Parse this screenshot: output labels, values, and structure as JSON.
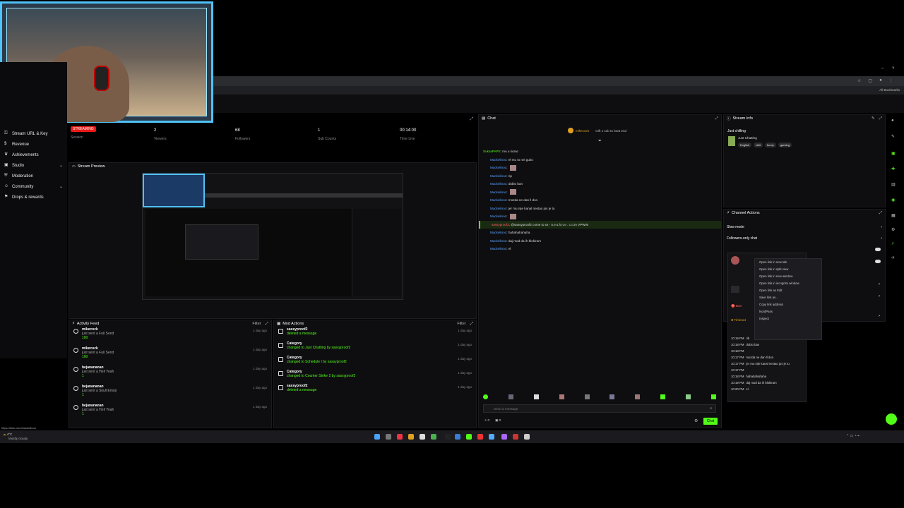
{
  "webcam": {
    "label": ""
  },
  "browser": {
    "bookmarks_label": "All Bookmarks"
  },
  "sidebar": {
    "items": [
      {
        "icon": "key-icon",
        "label": "Stream URL & Key",
        "chevron": false
      },
      {
        "icon": "dollar-icon",
        "label": "Revenue",
        "chevron": false
      },
      {
        "icon": "trophy-icon",
        "label": "Achievements",
        "chevron": false
      },
      {
        "icon": "studio-icon",
        "label": "Studio",
        "chevron": true
      },
      {
        "icon": "shield-icon",
        "label": "Moderation",
        "chevron": false
      },
      {
        "icon": "people-icon",
        "label": "Community",
        "chevron": true
      },
      {
        "icon": "gift-icon",
        "label": "Drops & rewards",
        "chevron": false
      }
    ]
  },
  "stats": {
    "status": "STREAMING",
    "session_label": "Session",
    "viewers": {
      "value": "2",
      "label": "Viewers"
    },
    "followers": {
      "value": "68",
      "label": "Followers"
    },
    "subs": {
      "value": "1",
      "label": "Sub Counts"
    },
    "time": {
      "value": "00:14:00",
      "label": "Time Live"
    }
  },
  "preview": {
    "title": "Stream Preview"
  },
  "activity": {
    "title": "Activity Feed",
    "filter": "Filter",
    "rows": [
      {
        "user": "mikecock",
        "desc": "just sent a Full Send",
        "amount": "100",
        "time": "1 day ago"
      },
      {
        "user": "mikecock",
        "desc": "just sent a Full Send",
        "amount": "100",
        "time": "1 day ago"
      },
      {
        "user": "bejanananan",
        "desc": "just sent a Hell Yeah",
        "amount": "1",
        "time": "1 day ago"
      },
      {
        "user": "bejanananan",
        "desc": "just sent a Skull Emoji",
        "amount": "1",
        "time": "1 day ago"
      },
      {
        "user": "bejanananan",
        "desc": "just sent a Hell Yeah",
        "amount": "1",
        "time": "1 day ago"
      }
    ]
  },
  "mod_actions": {
    "title": "Mod Actions",
    "filter": "Filter",
    "rows": [
      {
        "user": "sassyproof2",
        "desc": "deleted a message",
        "time": "1 day ago"
      },
      {
        "user": "Category",
        "desc": "changed to Just Chatting by sassyproof2",
        "time": "1 day ago"
      },
      {
        "user": "Category",
        "desc": "changed to Schedule I by sassyproof2",
        "time": "1 day ago"
      },
      {
        "user": "Category",
        "desc": "changed to Counter Strike 2 by sassyproof2",
        "time": "1 day ago"
      },
      {
        "user": "sassyproof2",
        "desc": "deleted a message",
        "time": "1 day ago"
      }
    ]
  },
  "chat": {
    "title": "Chat",
    "pinned_user": "mikecock",
    "pinned_note": "Gift 1 sub to beat 2nd",
    "lines": [
      {
        "user": "SuksaPAPE",
        "text": "mu u kurac",
        "pn": true
      },
      {
        "user": "Mackelinoo",
        "text": "el mu to nei guko"
      },
      {
        "user": "Mackelinoo",
        "text": ""
      },
      {
        "user": "Mackelinoo",
        "text": "rip"
      },
      {
        "user": "Mackelinoo",
        "text": "dobio ban"
      },
      {
        "user": "Mackelinoo",
        "text": ""
      },
      {
        "user": "Mackelinoo",
        "text": "mozda ne dan ll dva"
      },
      {
        "user": "Mackelinoo",
        "text": "jer mu nije kanal nestao jos je tu"
      },
      {
        "user": "Mackelinoo",
        "text": ""
      },
      {
        "user": "sassyproof2",
        "text": "@sassyproof2 come to xs - n.e.s.h.n.e . c.o.m VPWW",
        "hl": true
      },
      {
        "user": "Mackelinoo",
        "text": "hahahahahaha"
      },
      {
        "user": "Mackelinoo",
        "text": "daj mod da ih blokiram"
      },
      {
        "user": "Mackelinoo",
        "text": "el"
      }
    ],
    "placeholder": "Send a message",
    "send_label": "Chat",
    "kick_count": "0",
    "gift_count": "0"
  },
  "stream_info": {
    "title": "Stream Info",
    "stream_title": "Just chilling",
    "category": "Just Chatting",
    "tags": [
      "English",
      "chill",
      "funny",
      "gaming"
    ]
  },
  "channel_actions": {
    "title": "Channel Actions",
    "slow_mode": "Slow mode",
    "followers_only": "Followers-only chat"
  },
  "user_card": {
    "ban": "Ban",
    "timeout": "Timeout",
    "messages": [
      {
        "time": "10:19 PM",
        "text": "rib"
      },
      {
        "time": "10:18 PM",
        "text": "dobio ban"
      },
      {
        "time": "10:18 PM",
        "text": ""
      },
      {
        "time": "10:17 PM",
        "text": "mozda ne dan ll dva"
      },
      {
        "time": "10:17 PM",
        "text": "jer mu nije kanal nestao jos je tu"
      },
      {
        "time": "10:17 PM",
        "text": ""
      },
      {
        "time": "10:18 PM",
        "text": "hahahahahaha"
      },
      {
        "time": "10:19 PM",
        "text": "daj mod da ih blokiram"
      },
      {
        "time": "10:20 PM",
        "text": "el"
      }
    ]
  },
  "context_menu": {
    "items": [
      "Open link in new tab",
      "Open link in split view",
      "Open link in new window",
      "Open link in incognito window",
      "Open link as Edit",
      "Save link as...",
      "Copy link address",
      "NordPass",
      "Inspect"
    ]
  },
  "statusbar": {
    "url": "https://kick.com/mackelinoo"
  },
  "taskbar": {
    "weather": "Mostly cloudy",
    "temp": "4°C"
  }
}
